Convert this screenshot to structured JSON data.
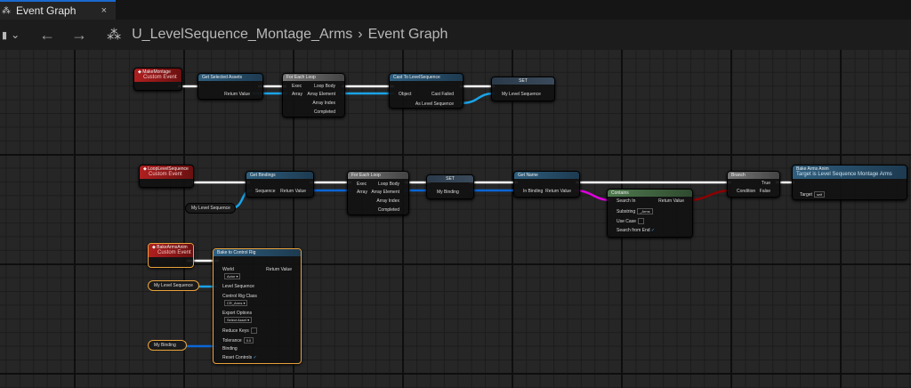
{
  "tab": {
    "title": "Event Graph",
    "close": "×",
    "icon": "graph-icon"
  },
  "toolbar": {
    "bookmark": "▮",
    "dropdown": "⌄",
    "back": "←",
    "forward": "→",
    "breadcrumb_root": "U_LevelSequence_Montage_Arms",
    "separator": "›",
    "breadcrumb_current": "Event Graph"
  },
  "colors": {
    "exec": "#ffffff",
    "object": "#1aa3e8",
    "struct": "#0a66d6",
    "string": "#e000e0",
    "bool": "#8c0000",
    "selected": "#e8a23c"
  },
  "row1": {
    "event": {
      "title": "MakeMontage",
      "subtitle": "Custom Event"
    },
    "get_selected": {
      "title": "Get Selected Assets",
      "return": "Return Value"
    },
    "foreach": {
      "title": "For Each Loop",
      "exec": "Exec",
      "array": "Array",
      "loop_body": "Loop Body",
      "element": "Array Element",
      "index": "Array Index",
      "completed": "Completed"
    },
    "cast": {
      "title": "Cast To LevelSequence",
      "object": "Object",
      "failed": "Cast Failed",
      "as": "As Level Sequence"
    },
    "set": {
      "title": "SET",
      "var": "My Level Sequence"
    }
  },
  "row2": {
    "event": {
      "title": "LoopLevelSequence",
      "subtitle": "Custom Event"
    },
    "get_bindings": {
      "title": "Get Bindings",
      "sequence": "Sequence",
      "return": "Return Value"
    },
    "var_seq": "My Level Sequence",
    "foreach": {
      "title": "For Each Loop",
      "exec": "Exec",
      "array": "Array",
      "loop_body": "Loop Body",
      "element": "Array Element",
      "index": "Array Index",
      "completed": "Completed"
    },
    "set": {
      "title": "SET",
      "var": "My Binding"
    },
    "get_name": {
      "title": "Get Name",
      "in": "In Binding",
      "return": "Return Value"
    },
    "contains": {
      "title": "Contains",
      "search_in": "Search In",
      "substring": "Substring",
      "substring_value": "_Arms",
      "use_case": "Use Case",
      "use_case_checked": false,
      "search_end": "Search from End",
      "search_end_checked": true,
      "return": "Return Value"
    },
    "branch": {
      "title": "Branch",
      "condition": "Condition",
      "true": "True",
      "false": "False"
    },
    "bake_arms": {
      "title": "Bake Arms Anim",
      "subtitle": "Target is Level Sequence Montage Arms",
      "target": "Target",
      "target_value": "self"
    }
  },
  "row3": {
    "event": {
      "title": "BakeArmsAnim",
      "subtitle": "Custom Event"
    },
    "var_seq": "My Level Sequence",
    "var_binding": "My Binding",
    "bake": {
      "title": "Bake to Control Rig",
      "world": "World",
      "world_value": "Actor ▾",
      "return": "Return Value",
      "level_sequence": "Level Sequence",
      "rig_class": "Control Rig Class",
      "rig_value": "CR_Arms ▾",
      "export": "Export Options",
      "export_value": "Select Asset ▾",
      "reduce": "Reduce Keys",
      "reduce_checked": false,
      "tolerance": "Tolerance",
      "tolerance_value": "0.0",
      "binding": "Binding",
      "reset": "Reset Controls",
      "reset_checked": true
    }
  }
}
